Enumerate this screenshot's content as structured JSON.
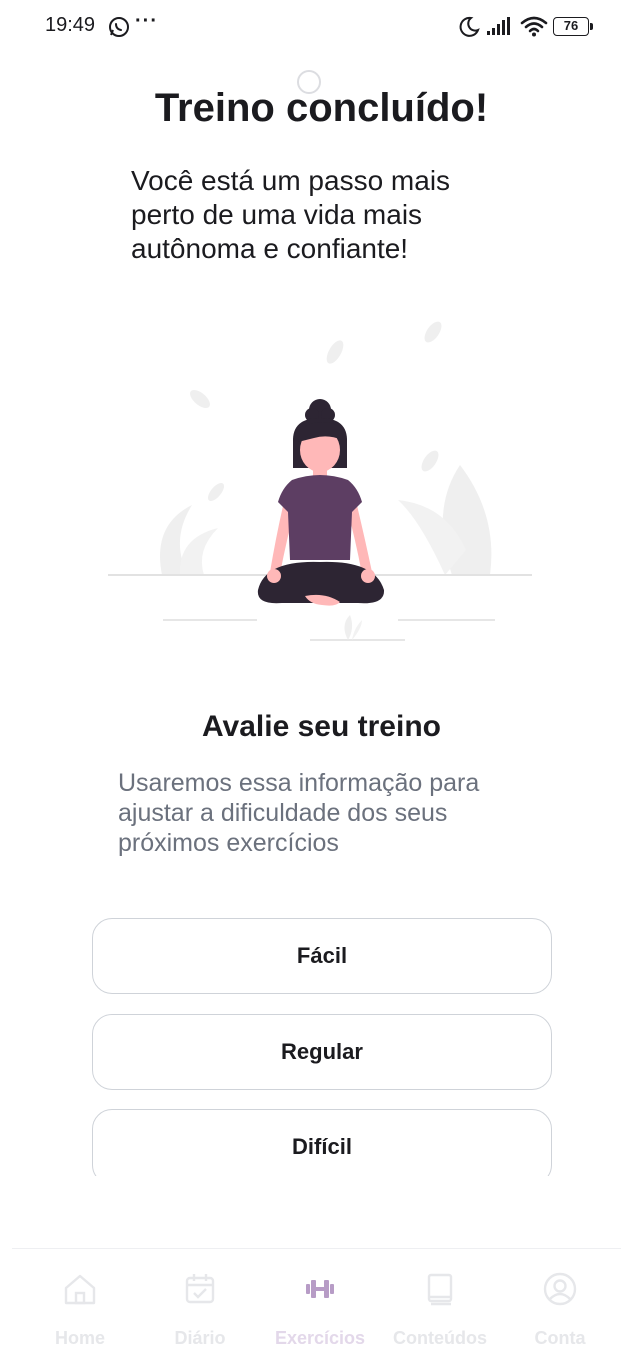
{
  "status_bar": {
    "time": "19:49",
    "dots": "···",
    "battery": "76"
  },
  "header": {
    "title": "Treino concluído!",
    "subtitle": "Você está um passo mais perto de uma vida mais autônoma e confiante!"
  },
  "illustration": {
    "subject": "meditating-woman",
    "colors": {
      "shirt": "#5d3e63",
      "pants": "#2d2533",
      "skin": "#ffb8b8",
      "hair": "#2d2533",
      "leaves": "#efefef"
    }
  },
  "rating": {
    "title": "Avalie seu treino",
    "description": "Usaremos essa informação para ajustar a dificuldade dos seus próximos exercícios",
    "options": [
      "Fácil",
      "Regular",
      "Difícil"
    ]
  },
  "bottom_nav": {
    "items": [
      {
        "label": "Home",
        "icon": "home-icon"
      },
      {
        "label": "Diário",
        "icon": "calendar-icon"
      },
      {
        "label": "Exercícios",
        "icon": "dumbbell-icon",
        "active": true
      },
      {
        "label": "Conteúdos",
        "icon": "book-icon"
      },
      {
        "label": "Conta",
        "icon": "user-icon"
      }
    ]
  },
  "colors": {
    "accent": "#6b4a7a",
    "text": "#1b1b1f",
    "muted": "#6b717d",
    "border": "#cfd3d9"
  }
}
